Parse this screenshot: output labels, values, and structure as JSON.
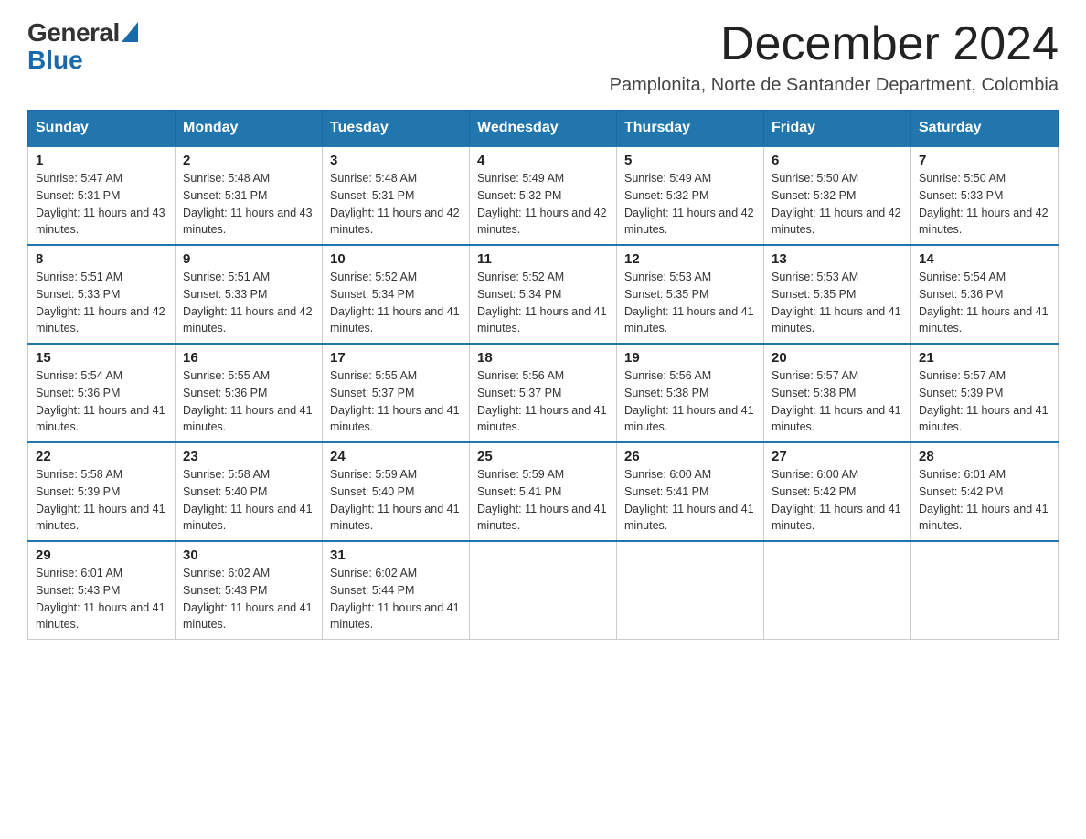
{
  "logo": {
    "general": "General",
    "blue": "Blue"
  },
  "title": {
    "month": "December 2024",
    "location": "Pamplonita, Norte de Santander Department, Colombia"
  },
  "weekdays": [
    "Sunday",
    "Monday",
    "Tuesday",
    "Wednesday",
    "Thursday",
    "Friday",
    "Saturday"
  ],
  "weeks": [
    [
      {
        "day": "1",
        "sunrise": "5:47 AM",
        "sunset": "5:31 PM",
        "daylight": "11 hours and 43 minutes."
      },
      {
        "day": "2",
        "sunrise": "5:48 AM",
        "sunset": "5:31 PM",
        "daylight": "11 hours and 43 minutes."
      },
      {
        "day": "3",
        "sunrise": "5:48 AM",
        "sunset": "5:31 PM",
        "daylight": "11 hours and 42 minutes."
      },
      {
        "day": "4",
        "sunrise": "5:49 AM",
        "sunset": "5:32 PM",
        "daylight": "11 hours and 42 minutes."
      },
      {
        "day": "5",
        "sunrise": "5:49 AM",
        "sunset": "5:32 PM",
        "daylight": "11 hours and 42 minutes."
      },
      {
        "day": "6",
        "sunrise": "5:50 AM",
        "sunset": "5:32 PM",
        "daylight": "11 hours and 42 minutes."
      },
      {
        "day": "7",
        "sunrise": "5:50 AM",
        "sunset": "5:33 PM",
        "daylight": "11 hours and 42 minutes."
      }
    ],
    [
      {
        "day": "8",
        "sunrise": "5:51 AM",
        "sunset": "5:33 PM",
        "daylight": "11 hours and 42 minutes."
      },
      {
        "day": "9",
        "sunrise": "5:51 AM",
        "sunset": "5:33 PM",
        "daylight": "11 hours and 42 minutes."
      },
      {
        "day": "10",
        "sunrise": "5:52 AM",
        "sunset": "5:34 PM",
        "daylight": "11 hours and 41 minutes."
      },
      {
        "day": "11",
        "sunrise": "5:52 AM",
        "sunset": "5:34 PM",
        "daylight": "11 hours and 41 minutes."
      },
      {
        "day": "12",
        "sunrise": "5:53 AM",
        "sunset": "5:35 PM",
        "daylight": "11 hours and 41 minutes."
      },
      {
        "day": "13",
        "sunrise": "5:53 AM",
        "sunset": "5:35 PM",
        "daylight": "11 hours and 41 minutes."
      },
      {
        "day": "14",
        "sunrise": "5:54 AM",
        "sunset": "5:36 PM",
        "daylight": "11 hours and 41 minutes."
      }
    ],
    [
      {
        "day": "15",
        "sunrise": "5:54 AM",
        "sunset": "5:36 PM",
        "daylight": "11 hours and 41 minutes."
      },
      {
        "day": "16",
        "sunrise": "5:55 AM",
        "sunset": "5:36 PM",
        "daylight": "11 hours and 41 minutes."
      },
      {
        "day": "17",
        "sunrise": "5:55 AM",
        "sunset": "5:37 PM",
        "daylight": "11 hours and 41 minutes."
      },
      {
        "day": "18",
        "sunrise": "5:56 AM",
        "sunset": "5:37 PM",
        "daylight": "11 hours and 41 minutes."
      },
      {
        "day": "19",
        "sunrise": "5:56 AM",
        "sunset": "5:38 PM",
        "daylight": "11 hours and 41 minutes."
      },
      {
        "day": "20",
        "sunrise": "5:57 AM",
        "sunset": "5:38 PM",
        "daylight": "11 hours and 41 minutes."
      },
      {
        "day": "21",
        "sunrise": "5:57 AM",
        "sunset": "5:39 PM",
        "daylight": "11 hours and 41 minutes."
      }
    ],
    [
      {
        "day": "22",
        "sunrise": "5:58 AM",
        "sunset": "5:39 PM",
        "daylight": "11 hours and 41 minutes."
      },
      {
        "day": "23",
        "sunrise": "5:58 AM",
        "sunset": "5:40 PM",
        "daylight": "11 hours and 41 minutes."
      },
      {
        "day": "24",
        "sunrise": "5:59 AM",
        "sunset": "5:40 PM",
        "daylight": "11 hours and 41 minutes."
      },
      {
        "day": "25",
        "sunrise": "5:59 AM",
        "sunset": "5:41 PM",
        "daylight": "11 hours and 41 minutes."
      },
      {
        "day": "26",
        "sunrise": "6:00 AM",
        "sunset": "5:41 PM",
        "daylight": "11 hours and 41 minutes."
      },
      {
        "day": "27",
        "sunrise": "6:00 AM",
        "sunset": "5:42 PM",
        "daylight": "11 hours and 41 minutes."
      },
      {
        "day": "28",
        "sunrise": "6:01 AM",
        "sunset": "5:42 PM",
        "daylight": "11 hours and 41 minutes."
      }
    ],
    [
      {
        "day": "29",
        "sunrise": "6:01 AM",
        "sunset": "5:43 PM",
        "daylight": "11 hours and 41 minutes."
      },
      {
        "day": "30",
        "sunrise": "6:02 AM",
        "sunset": "5:43 PM",
        "daylight": "11 hours and 41 minutes."
      },
      {
        "day": "31",
        "sunrise": "6:02 AM",
        "sunset": "5:44 PM",
        "daylight": "11 hours and 41 minutes."
      },
      null,
      null,
      null,
      null
    ]
  ],
  "labels": {
    "sunrise": "Sunrise: ",
    "sunset": "Sunset: ",
    "daylight": "Daylight: "
  }
}
